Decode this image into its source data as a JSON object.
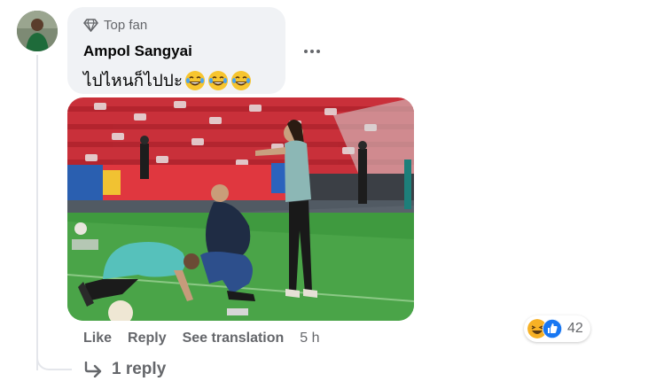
{
  "comment": {
    "badge_label": "Top fan",
    "author": "Ampol Sangyai",
    "text": "ไปไหนก็ไปปะ",
    "text_emojis": [
      "laughing-tears-emoji",
      "laughing-tears-emoji",
      "laughing-tears-emoji"
    ],
    "actions": {
      "like": "Like",
      "reply": "Reply",
      "see_translation": "See translation",
      "time": "5 h"
    },
    "reactions": {
      "icons": [
        "haha-reaction-icon",
        "like-reaction-icon"
      ],
      "count": "42"
    },
    "replies_label": "1 reply"
  },
  "colors": {
    "bubble_bg": "#f0f2f5",
    "secondary_text": "#65676b",
    "like_blue": "#1877f2",
    "haha_yellow": "#f7b125"
  }
}
